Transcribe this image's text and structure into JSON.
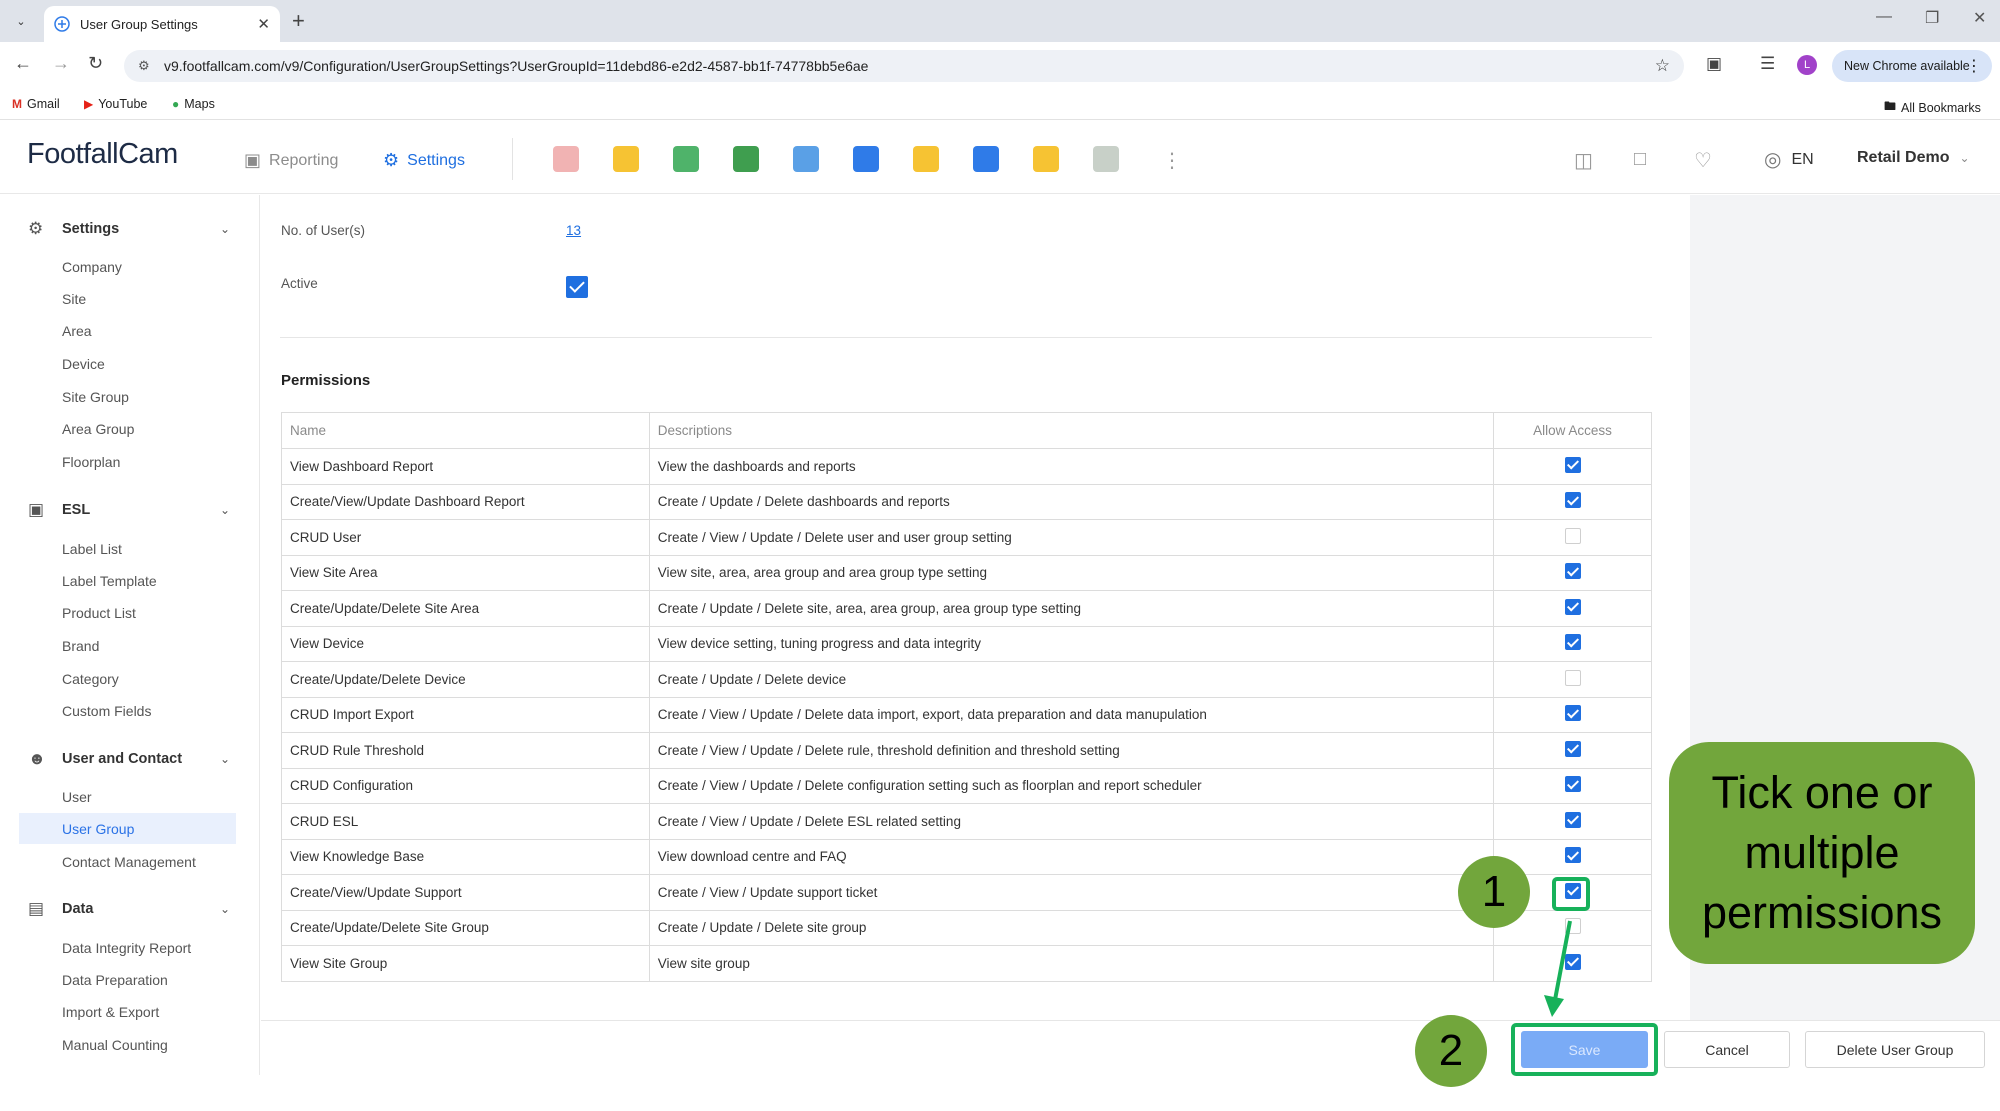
{
  "browser": {
    "tab_title": "User Group Settings",
    "url": "v9.footfallcam.com/v9/Configuration/UserGroupSettings?UserGroupId=11debd86-e2d2-4587-bb1f-74778bb5e6ae",
    "profile_initial": "L",
    "new_chrome_label": "New Chrome available",
    "bookmarks": [
      "Gmail",
      "YouTube",
      "Maps"
    ],
    "all_bookmarks_label": "All Bookmarks"
  },
  "header": {
    "logo_text": "FootfallCam",
    "nav_reporting": "Reporting",
    "nav_settings": "Settings",
    "language": "EN",
    "account": "Retail Demo"
  },
  "sidebar": {
    "settings": {
      "title": "Settings",
      "items": [
        "Company",
        "Site",
        "Area",
        "Device",
        "Site Group",
        "Area Group",
        "Floorplan"
      ]
    },
    "esl": {
      "title": "ESL",
      "items": [
        "Label List",
        "Label Template",
        "Product List",
        "Brand",
        "Category",
        "Custom Fields"
      ]
    },
    "user_contact": {
      "title": "User and Contact",
      "items": [
        "User",
        "User Group",
        "Contact Management"
      ]
    },
    "data": {
      "title": "Data",
      "items": [
        "Data Integrity Report",
        "Data Preparation",
        "Import & Export",
        "Manual Counting"
      ]
    }
  },
  "form": {
    "users_label": "No. of User(s)",
    "users_count": "13",
    "active_label": "Active",
    "active_checked": true
  },
  "permissions": {
    "title": "Permissions",
    "columns": [
      "Name",
      "Descriptions",
      "Allow Access"
    ],
    "rows": [
      {
        "name": "View Dashboard Report",
        "desc": "View the dashboards and reports",
        "allowed": true
      },
      {
        "name": "Create/View/Update Dashboard Report",
        "desc": "Create / Update / Delete dashboards and reports",
        "allowed": true
      },
      {
        "name": "CRUD User",
        "desc": "Create / View / Update / Delete user and user group setting",
        "allowed": false
      },
      {
        "name": "View Site Area",
        "desc": "View site, area, area group and area group type setting",
        "allowed": true
      },
      {
        "name": "Create/Update/Delete Site Area",
        "desc": "Create / Update / Delete site, area, area group, area group type setting",
        "allowed": true
      },
      {
        "name": "View Device",
        "desc": "View device setting, tuning progress and data integrity",
        "allowed": true
      },
      {
        "name": "Create/Update/Delete Device",
        "desc": "Create / Update / Delete device",
        "allowed": false
      },
      {
        "name": "CRUD Import Export",
        "desc": "Create / View / Update / Delete data import, export, data preparation and data manupulation",
        "allowed": true
      },
      {
        "name": "CRUD Rule Threshold",
        "desc": "Create / View / Update / Delete rule, threshold definition and threshold setting",
        "allowed": true
      },
      {
        "name": "CRUD Configuration",
        "desc": "Create / View / Update / Delete configuration setting such as floorplan and report scheduler",
        "allowed": true
      },
      {
        "name": "CRUD ESL",
        "desc": "Create / View / Update / Delete ESL related setting",
        "allowed": true
      },
      {
        "name": "View Knowledge Base",
        "desc": "View download centre and FAQ",
        "allowed": true
      },
      {
        "name": "Create/View/Update Support",
        "desc": "Create / View / Update support ticket",
        "allowed": true
      },
      {
        "name": "Create/Update/Delete Site Group",
        "desc": "Create / Update / Delete site group",
        "allowed": false
      },
      {
        "name": "View Site Group",
        "desc": "View site group",
        "allowed": true
      }
    ]
  },
  "footer": {
    "save": "Save",
    "cancel": "Cancel",
    "delete": "Delete User Group"
  },
  "annotations": {
    "step1": "1",
    "step2": "2",
    "callout": "Tick one or multiple permissions",
    "color_green": "#72a63c",
    "color_highlight": "#17b15a"
  },
  "colors": {
    "accent": "#1f6fe0",
    "save_disabled": "#7aabf6"
  }
}
